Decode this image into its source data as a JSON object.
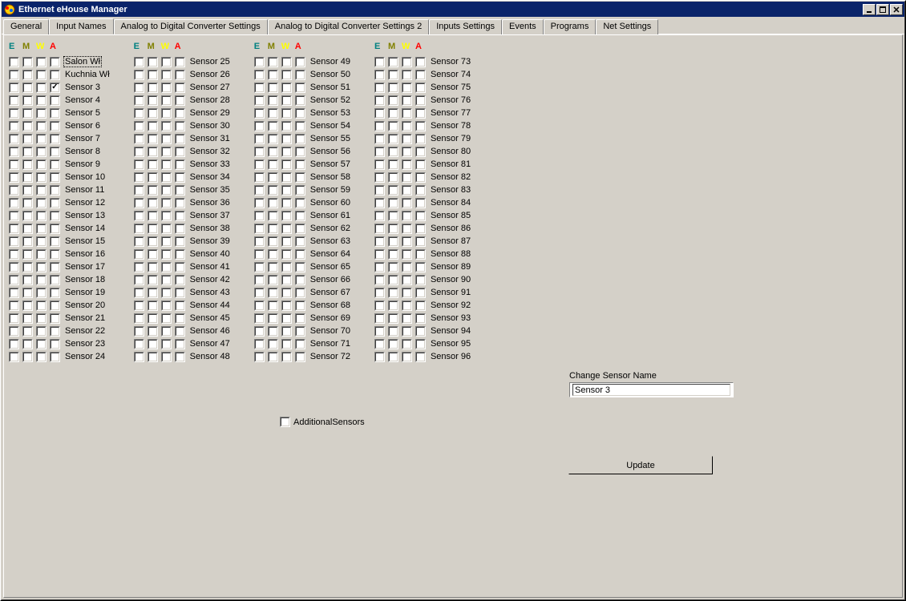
{
  "window": {
    "title": "Ethernet eHouse Manager"
  },
  "tabs": [
    {
      "label": "General"
    },
    {
      "label": "Input Names",
      "active": true
    },
    {
      "label": "Analog to Digital Converter Settings"
    },
    {
      "label": "Analog to Digital Converter Settings 2"
    },
    {
      "label": "Inputs Settings"
    },
    {
      "label": "Events"
    },
    {
      "label": "Programs"
    },
    {
      "label": "Net Settings"
    }
  ],
  "headers": {
    "E": "E",
    "M": "M",
    "W": "W",
    "A": "A"
  },
  "columns": [
    [
      {
        "label": "Salon Wł",
        "selected": true,
        "a": false
      },
      {
        "label": "Kuchnia Wł",
        "a": false
      },
      {
        "label": "Sensor 3",
        "a": true
      },
      {
        "label": "Sensor 4",
        "a": false
      },
      {
        "label": "Sensor 5",
        "a": false
      },
      {
        "label": "Sensor 6",
        "a": false
      },
      {
        "label": "Sensor 7",
        "a": false
      },
      {
        "label": "Sensor 8",
        "a": false
      },
      {
        "label": "Sensor 9",
        "a": false
      },
      {
        "label": "Sensor 10",
        "a": false
      },
      {
        "label": "Sensor 11",
        "a": false
      },
      {
        "label": "Sensor 12",
        "a": false
      },
      {
        "label": "Sensor 13",
        "a": false
      },
      {
        "label": "Sensor 14",
        "a": false
      },
      {
        "label": "Sensor 15",
        "a": false
      },
      {
        "label": "Sensor 16",
        "a": false
      },
      {
        "label": "Sensor 17",
        "a": false
      },
      {
        "label": "Sensor 18",
        "a": false
      },
      {
        "label": "Sensor 19",
        "a": false
      },
      {
        "label": "Sensor 20",
        "a": false
      },
      {
        "label": "Sensor 21",
        "a": false
      },
      {
        "label": "Sensor 22",
        "a": false
      },
      {
        "label": "Sensor 23",
        "a": false
      },
      {
        "label": "Sensor 24",
        "a": false
      }
    ],
    [
      {
        "label": "Sensor 25",
        "a": false
      },
      {
        "label": "Sensor 26",
        "a": false
      },
      {
        "label": "Sensor 27",
        "a": false
      },
      {
        "label": "Sensor 28",
        "a": false
      },
      {
        "label": "Sensor 29",
        "a": false
      },
      {
        "label": "Sensor 30",
        "a": false
      },
      {
        "label": "Sensor 31",
        "a": false
      },
      {
        "label": "Sensor 32",
        "a": false
      },
      {
        "label": "Sensor 33",
        "a": false
      },
      {
        "label": "Sensor 34",
        "a": false
      },
      {
        "label": "Sensor 35",
        "a": false
      },
      {
        "label": "Sensor 36",
        "a": false
      },
      {
        "label": "Sensor 37",
        "a": false
      },
      {
        "label": "Sensor 38",
        "a": false
      },
      {
        "label": "Sensor 39",
        "a": false
      },
      {
        "label": "Sensor 40",
        "a": false
      },
      {
        "label": "Sensor 41",
        "a": false
      },
      {
        "label": "Sensor 42",
        "a": false
      },
      {
        "label": "Sensor 43",
        "a": false
      },
      {
        "label": "Sensor 44",
        "a": false
      },
      {
        "label": "Sensor 45",
        "a": false
      },
      {
        "label": "Sensor 46",
        "a": false
      },
      {
        "label": "Sensor 47",
        "a": false
      },
      {
        "label": "Sensor 48",
        "a": false
      }
    ],
    [
      {
        "label": "Sensor 49",
        "a": false
      },
      {
        "label": "Sensor 50",
        "a": false
      },
      {
        "label": "Sensor 51",
        "a": false
      },
      {
        "label": "Sensor 52",
        "a": false
      },
      {
        "label": "Sensor 53",
        "a": false
      },
      {
        "label": "Sensor 54",
        "a": false
      },
      {
        "label": "Sensor 55",
        "a": false
      },
      {
        "label": "Sensor 56",
        "a": false
      },
      {
        "label": "Sensor 57",
        "a": false
      },
      {
        "label": "Sensor 58",
        "a": false
      },
      {
        "label": "Sensor 59",
        "a": false
      },
      {
        "label": "Sensor 60",
        "a": false
      },
      {
        "label": "Sensor 61",
        "a": false
      },
      {
        "label": "Sensor 62",
        "a": false
      },
      {
        "label": "Sensor 63",
        "a": false
      },
      {
        "label": "Sensor 64",
        "a": false
      },
      {
        "label": "Sensor 65",
        "a": false
      },
      {
        "label": "Sensor 66",
        "a": false
      },
      {
        "label": "Sensor 67",
        "a": false
      },
      {
        "label": "Sensor 68",
        "a": false
      },
      {
        "label": "Sensor 69",
        "a": false
      },
      {
        "label": "Sensor 70",
        "a": false
      },
      {
        "label": "Sensor 71",
        "a": false
      },
      {
        "label": "Sensor 72",
        "a": false
      }
    ],
    [
      {
        "label": "Sensor 73",
        "a": false
      },
      {
        "label": "Sensor 74",
        "a": false
      },
      {
        "label": "Sensor 75",
        "a": false
      },
      {
        "label": "Sensor 76",
        "a": false
      },
      {
        "label": "Sensor 77",
        "a": false
      },
      {
        "label": "Sensor 78",
        "a": false
      },
      {
        "label": "Sensor 79",
        "a": false
      },
      {
        "label": "Sensor 80",
        "a": false
      },
      {
        "label": "Sensor 81",
        "a": false
      },
      {
        "label": "Sensor 82",
        "a": false
      },
      {
        "label": "Sensor 83",
        "a": false
      },
      {
        "label": "Sensor 84",
        "a": false
      },
      {
        "label": "Sensor 85",
        "a": false
      },
      {
        "label": "Sensor 86",
        "a": false
      },
      {
        "label": "Sensor 87",
        "a": false
      },
      {
        "label": "Sensor 88",
        "a": false
      },
      {
        "label": "Sensor 89",
        "a": false
      },
      {
        "label": "Sensor 90",
        "a": false
      },
      {
        "label": "Sensor 91",
        "a": false
      },
      {
        "label": "Sensor 92",
        "a": false
      },
      {
        "label": "Sensor 93",
        "a": false
      },
      {
        "label": "Sensor 94",
        "a": false
      },
      {
        "label": "Sensor 95",
        "a": false
      },
      {
        "label": "Sensor 96",
        "a": false
      }
    ]
  ],
  "additional_sensors": {
    "label": "AdditionalSensors",
    "checked": false
  },
  "change_name": {
    "label": "Change Sensor Name",
    "value": "Sensor 3"
  },
  "update_button": "Update"
}
